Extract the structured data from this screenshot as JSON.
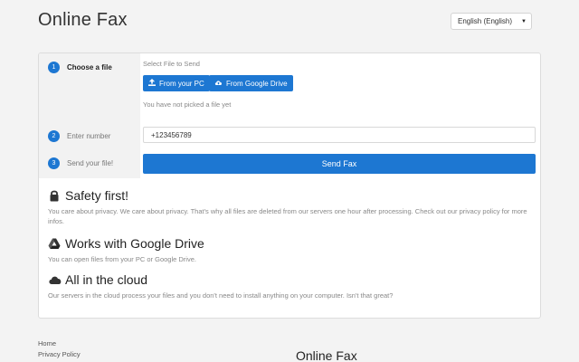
{
  "app": {
    "title": "Online Fax"
  },
  "language": {
    "selected": "English (English)"
  },
  "steps": [
    {
      "number": "1",
      "label": "Choose a file"
    },
    {
      "number": "2",
      "label": "Enter number"
    },
    {
      "number": "3",
      "label": "Send your file!"
    }
  ],
  "upload": {
    "label": "Select File to Send",
    "from_pc": "From your PC",
    "from_drive": "From Google Drive",
    "status": "You have not picked a file yet"
  },
  "number_field": {
    "value": "+123456789"
  },
  "send_button": "Send Fax",
  "features": [
    {
      "icon": "lock-icon",
      "title": "Safety first!",
      "text": "You care about privacy. We care about privacy. That's why all files are deleted from our servers one hour after processing. Check out our privacy policy for more infos."
    },
    {
      "icon": "google-drive-icon",
      "title": "Works with Google Drive",
      "text": "You can open files from your PC or Google Drive."
    },
    {
      "icon": "cloud-icon",
      "title": "All in the cloud",
      "text": "Our servers in the cloud process your files and you don't need to install anything on your computer. Isn't that great?"
    }
  ],
  "footer": {
    "links": [
      "Home",
      "Privacy Policy"
    ],
    "title": "Online Fax"
  },
  "colors": {
    "accent": "#1d77d2"
  }
}
